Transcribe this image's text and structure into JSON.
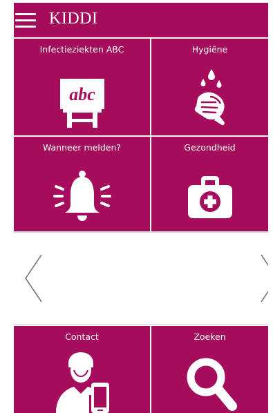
{
  "header": {
    "title": "KIDDI",
    "menu_icon": "hamburger-menu-icon"
  },
  "tiles": [
    {
      "label": "Infectieziekten ABC",
      "icon": "abc-easel-icon",
      "icon_text": "abc"
    },
    {
      "label": "Hygiëne",
      "icon": "hand-washing-icon"
    },
    {
      "label": "Wanneer melden?",
      "icon": "bell-alert-icon"
    },
    {
      "label": "Gezondheid",
      "icon": "first-aid-kit-icon"
    },
    {
      "label": "Contact",
      "icon": "person-phone-icon"
    },
    {
      "label": "Zoeken",
      "icon": "magnifier-icon"
    }
  ],
  "carousel": {
    "prev_icon": "chevron-left-icon",
    "next_icon": "chevron-right-icon"
  },
  "colors": {
    "brand": "#a50d5c",
    "foreground": "#ffffff"
  }
}
